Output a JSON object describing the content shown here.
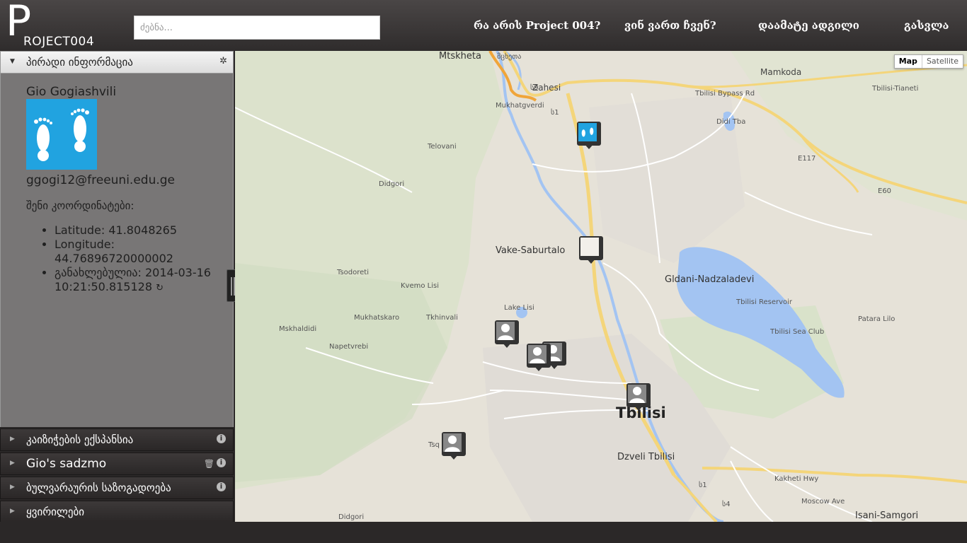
{
  "header": {
    "logo_big": "P",
    "logo_rest": "ROJECT004",
    "search_placeholder": "ძებნა...",
    "nav": [
      "რა არის Project 004?",
      "ვინ ვართ ჩვენ?",
      "დაამატე ადგილი",
      "გასვლა"
    ]
  },
  "sidebar": {
    "open_section": "პირადი ინფორმაცია",
    "user": {
      "name": "Gio Gogiashvili",
      "email": "ggogi12@freeuni.edu.ge",
      "coords_label": "შენი კოორდინატები:",
      "latitude": "Latitude: 41.8048265",
      "longitude": "Longitude: 44.76896720000002",
      "updated": "განახლებულია: 2014-03-16 10:21:50.815128"
    },
    "sections": [
      {
        "label": "კაიზიჭების ექსპანსია"
      },
      {
        "label": "Gio's sadzmo"
      },
      {
        "label": "ბულვარაურის საზოგადოება"
      },
      {
        "label": "ყვირილები"
      }
    ]
  },
  "map": {
    "type_buttons": [
      "Map",
      "Satellite"
    ],
    "labels": {
      "mtskheta": "Mtskheta",
      "mtskheta_geo": "მცხეთა",
      "zahesi": "Zahesi",
      "mamkoda": "Mamkoda",
      "tbilisi_bypass": "Tbilisi Bypass Rd",
      "tianeti": "Tbilisi-Tianeti",
      "mukhatgverdi": "Mukhatgverdi",
      "telovani": "Telovani",
      "didgori": "Didgori",
      "didgori2": "Didgori",
      "vake": "Vake-Saburtalo",
      "tsodoreti": "Tsodoreti",
      "kvemo_lisi": "Kvemo Lisi",
      "gldani": "Gldani-Nadzaladevi",
      "reservoir": "Tbilisi Reservoir",
      "sea_club": "Tbilisi Sea Club",
      "patara_lilo": "Patara Lilo",
      "lake_lisi": "Lake Lisi",
      "mukhatskaro": "Mukhatskaro",
      "tkhinvali": "Tkhinvali",
      "mskhaldidi": "Mskhaldidi",
      "napetvrebi": "Napetvrebi",
      "tbilisi": "Tbilisi",
      "dzveli": "Dzveli Tbilisi",
      "isani": "Isani-Samgori",
      "didi_tba": "Didi Tba",
      "kakheti": "Kakheti Hwy",
      "moscow": "Moscow Ave",
      "e117": "E117",
      "e60": "E60",
      "s9": "ს9",
      "s1": "ს1",
      "s1b": "ს1",
      "s4": "ს4",
      "gorge": "Tsq"
    }
  }
}
